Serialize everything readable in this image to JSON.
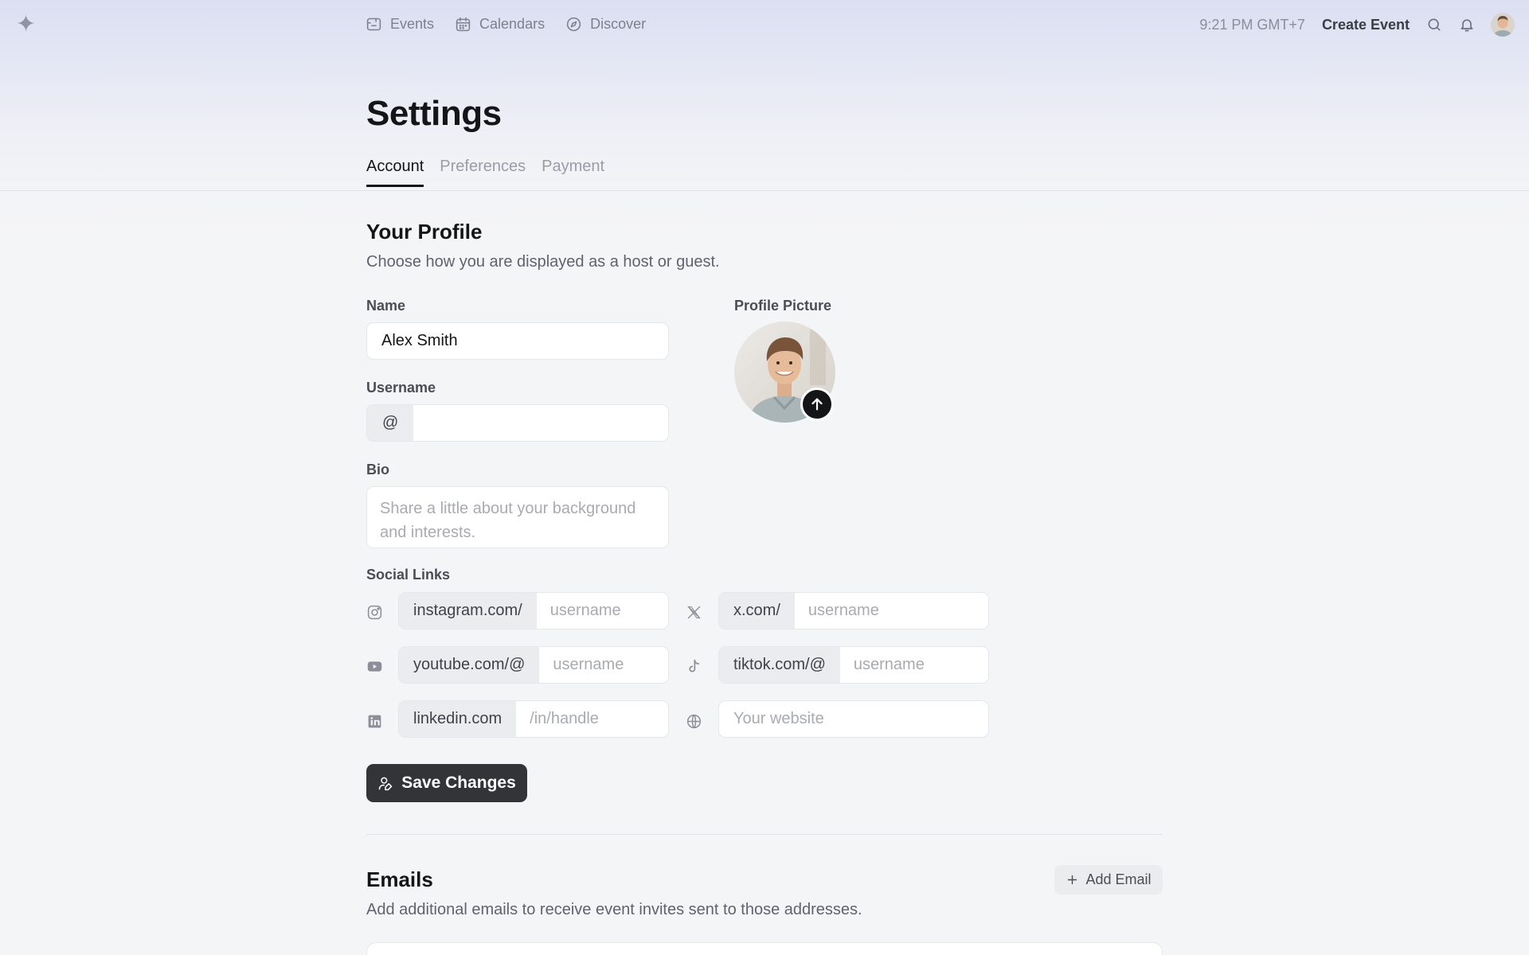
{
  "nav": {
    "links": [
      {
        "label": "Events",
        "icon": "ticket-icon"
      },
      {
        "label": "Calendars",
        "icon": "calendar-icon"
      },
      {
        "label": "Discover",
        "icon": "compass-icon"
      }
    ],
    "time": "9:21 PM GMT+7",
    "create_event": "Create Event"
  },
  "page": {
    "title": "Settings",
    "tabs": [
      "Account",
      "Preferences",
      "Payment"
    ],
    "active_tab": "Account"
  },
  "profile": {
    "title": "Your Profile",
    "subtitle": "Choose how you are displayed as a host or guest.",
    "name_label": "Name",
    "name_value": "Alex Smith",
    "username_label": "Username",
    "username_prefix": "@",
    "username_value": "",
    "bio_label": "Bio",
    "bio_placeholder": "Share a little about your background and interests.",
    "picture_label": "Profile Picture"
  },
  "social": {
    "label": "Social Links",
    "instagram": {
      "prefix": "instagram.com/",
      "placeholder": "username"
    },
    "x": {
      "prefix": "x.com/",
      "placeholder": "username"
    },
    "youtube": {
      "prefix": "youtube.com/@",
      "placeholder": "username"
    },
    "tiktok": {
      "prefix": "tiktok.com/@",
      "placeholder": "username"
    },
    "linkedin": {
      "prefix": "linkedin.com",
      "placeholder": "/in/handle"
    },
    "website": {
      "placeholder": "Your website"
    }
  },
  "actions": {
    "save": "Save Changes"
  },
  "emails": {
    "title": "Emails",
    "subtitle": "Add additional emails to receive event invites sent to those addresses.",
    "add": "Add Email"
  },
  "colors": {
    "primary_button": "#333437",
    "accent_tab": "#131517",
    "header_gradient_top": "#dcdff2"
  }
}
